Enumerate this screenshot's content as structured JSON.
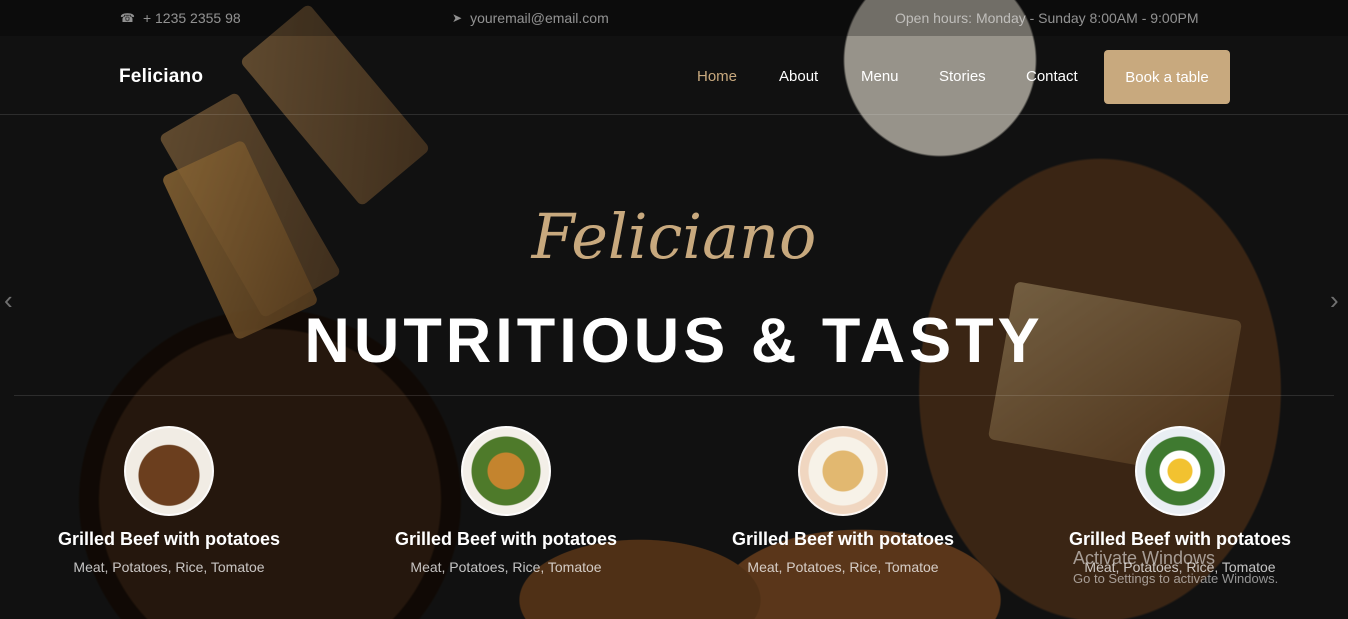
{
  "topbar": {
    "phone": "+ 1235 2355 98",
    "email": "youremail@email.com",
    "hours": "Open hours: Monday - Sunday 8:00AM - 9:00PM"
  },
  "navbar": {
    "brand": "Feliciano",
    "items": [
      "Home",
      "About",
      "Menu",
      "Stories",
      "Contact"
    ],
    "active": "Home",
    "cta": "Book a table"
  },
  "hero": {
    "script_title": "Feliciano",
    "title": "NUTRITIOUS & TASTY"
  },
  "dishes": [
    {
      "name": "Grilled Beef with potatoes",
      "description": "Meat, Potatoes, Rice, Tomatoe"
    },
    {
      "name": "Grilled Beef with potatoes",
      "description": "Meat, Potatoes, Rice, Tomatoe"
    },
    {
      "name": "Grilled Beef with potatoes",
      "description": "Meat, Potatoes, Rice, Tomatoe"
    },
    {
      "name": "Grilled Beef with potatoes",
      "description": "Meat, Potatoes, Rice, Tomatoe"
    }
  ],
  "watermark": {
    "line1": "Activate Windows",
    "line2": "Go to Settings to activate Windows."
  },
  "colors": {
    "accent": "#c8a97e",
    "background": "#1b1b1b"
  },
  "icons": {
    "phone": "phone-icon",
    "email": "paper-plane-icon",
    "prev": "chevron-left-icon",
    "next": "chevron-right-icon"
  }
}
